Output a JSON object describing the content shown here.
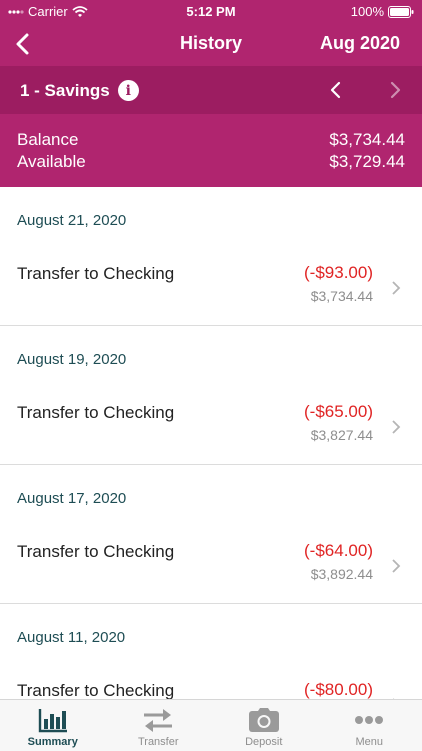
{
  "status": {
    "carrier": "Carrier",
    "time": "5:12 PM",
    "battery": "100%"
  },
  "nav": {
    "title": "History",
    "month": "Aug 2020"
  },
  "account": {
    "name": "1 - Savings",
    "info_glyph": "i"
  },
  "balance": {
    "balance_label": "Balance",
    "balance_value": "$3,734.44",
    "available_label": "Available",
    "available_value": "$3,729.44"
  },
  "transactions": [
    {
      "date": "August 21, 2020",
      "description": "Transfer to Checking",
      "amount": "(-$93.00)",
      "running": "$3,734.44"
    },
    {
      "date": "August 19, 2020",
      "description": "Transfer to Checking",
      "amount": "(-$65.00)",
      "running": "$3,827.44"
    },
    {
      "date": "August 17, 2020",
      "description": "Transfer to Checking",
      "amount": "(-$64.00)",
      "running": "$3,892.44"
    },
    {
      "date": "August 11, 2020",
      "description": "Transfer to Checking",
      "amount": "(-$80.00)",
      "running": ""
    }
  ],
  "tabs": [
    {
      "label": "Summary",
      "icon": "bar-chart-icon",
      "active": true
    },
    {
      "label": "Transfer",
      "icon": "transfer-arrows-icon",
      "active": false
    },
    {
      "label": "Deposit",
      "icon": "camera-icon",
      "active": false
    },
    {
      "label": "Menu",
      "icon": "more-dots-icon",
      "active": false
    }
  ],
  "colors": {
    "header": "#b0256f",
    "account_bar": "#9c1d61",
    "negative": "#e02424",
    "date_text": "#1e4d54"
  }
}
